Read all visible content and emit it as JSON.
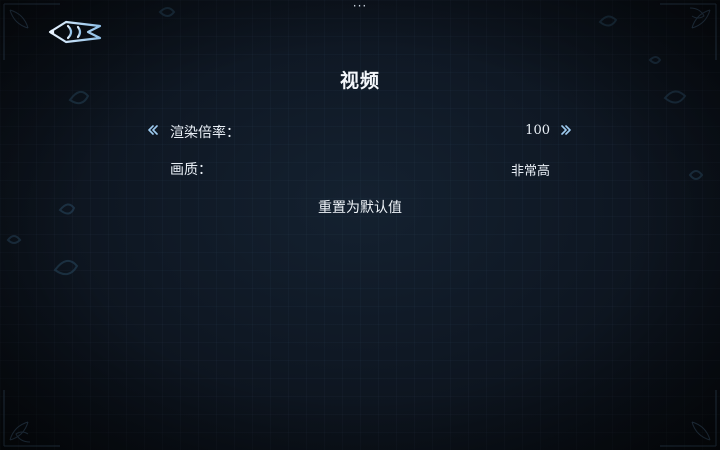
{
  "header": {
    "menu_glyph": "···",
    "back_icon": "winged-arrow-back-icon"
  },
  "page": {
    "title": "视频"
  },
  "settings": [
    {
      "id": "render_scale",
      "label": "渲染倍率：",
      "value": "100",
      "has_arrows": true
    },
    {
      "id": "quality",
      "label": "画质：",
      "value": "非常高",
      "has_arrows": false
    }
  ],
  "reset": {
    "label": "重置为默认值"
  },
  "theme": {
    "accent": "#9ecbf0",
    "text": "#eef3f8",
    "background": "#0f1824"
  }
}
